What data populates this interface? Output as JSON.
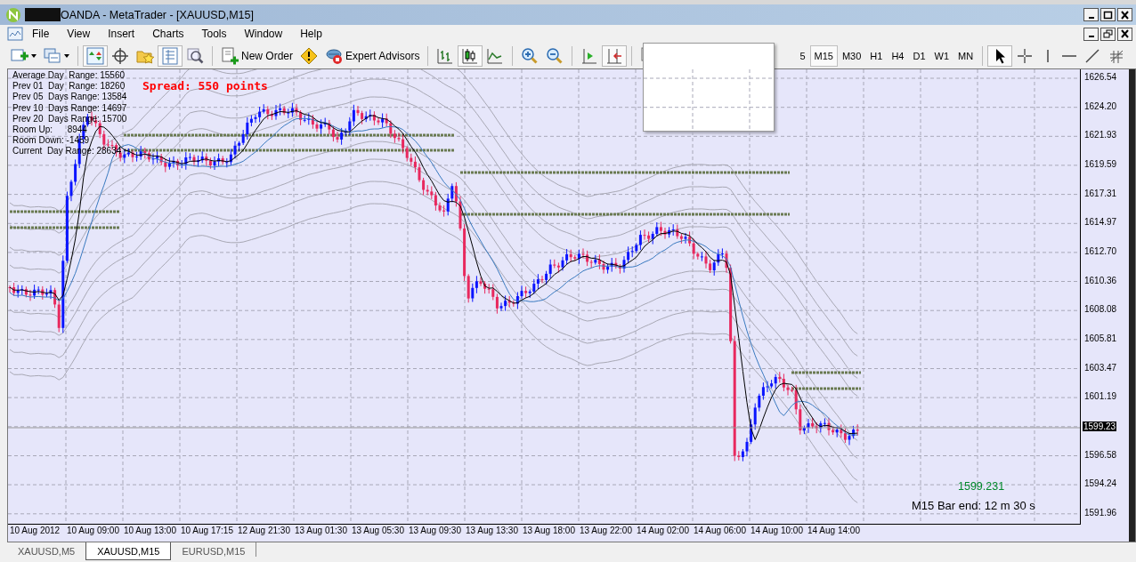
{
  "window": {
    "title": "OANDA - MetaTrader - [XAUUSD,M15]"
  },
  "menu": [
    "File",
    "View",
    "Insert",
    "Charts",
    "Tools",
    "Window",
    "Help"
  ],
  "toolbar": {
    "items": [
      {
        "kind": "icon",
        "pressed": false,
        "caret": true
      },
      {
        "kind": "icon",
        "pressed": false,
        "caret": true
      },
      {
        "kind": "sep"
      },
      {
        "kind": "icon",
        "pressed": true
      },
      {
        "kind": "icon",
        "pressed": false
      },
      {
        "kind": "icon",
        "pressed": false
      },
      {
        "kind": "icon",
        "pressed": true
      },
      {
        "kind": "icon",
        "pressed": false
      },
      {
        "kind": "sep"
      },
      {
        "kind": "text",
        "label": "New Order",
        "pressed": false
      },
      {
        "kind": "icon",
        "pressed": false
      },
      {
        "kind": "text",
        "label": "Expert Advisors",
        "pressed": false
      },
      {
        "kind": "sep"
      },
      {
        "kind": "icon",
        "pressed": false
      },
      {
        "kind": "icon",
        "pressed": true
      },
      {
        "kind": "icon",
        "pressed": false
      },
      {
        "kind": "sep"
      },
      {
        "kind": "icon",
        "pressed": false
      },
      {
        "kind": "icon",
        "pressed": false
      },
      {
        "kind": "sep"
      },
      {
        "kind": "icon",
        "pressed": false
      },
      {
        "kind": "icon",
        "pressed": true
      },
      {
        "kind": "sep"
      },
      {
        "kind": "icon"
      }
    ]
  },
  "timeframes": [
    {
      "label": "5",
      "selected": false
    },
    {
      "label": "M15",
      "selected": true
    },
    {
      "label": "M30",
      "selected": false
    },
    {
      "label": "H1",
      "selected": false
    },
    {
      "label": "H4",
      "selected": false
    },
    {
      "label": "D1",
      "selected": false
    },
    {
      "label": "W1",
      "selected": false
    },
    {
      "label": "MN",
      "selected": false
    }
  ],
  "drawing_tools": [
    {
      "pressed": true
    },
    {
      "pressed": false
    },
    {
      "pressed": false
    },
    {
      "pressed": false
    },
    {
      "pressed": false
    },
    {
      "pressed": false
    }
  ],
  "chart": {
    "info_lines": [
      "Average Day  Range: 15560",
      "Prev 01  Day  Range: 18260",
      "Prev 05  Days Range: 13584",
      "Prev 10  Days Range: 14697",
      "Prev 20  Days Range: 15700",
      "Room Up:      8944",
      "Room Down: -1459",
      "Current  Day Range: 28634"
    ],
    "spread": "Spread: 550 points",
    "bid": "1599.231",
    "bar_end": "M15 Bar end: 12 m 30 s",
    "price_labels": [
      "1626.54",
      "1624.20",
      "1621.93",
      "1619.59",
      "1617.31",
      "1614.97",
      "1612.70",
      "1610.36",
      "1608.08",
      "1605.81",
      "1603.47",
      "1601.19",
      "1596.58",
      "1594.24",
      "1591.96"
    ],
    "current_price": "1599.23",
    "time_labels": [
      "10 Aug 2012",
      "10 Aug 09:00",
      "10 Aug 13:00",
      "10 Aug 17:15",
      "12 Aug 21:30",
      "13 Aug 01:30",
      "13 Aug 05:30",
      "13 Aug 09:30",
      "13 Aug 13:30",
      "13 Aug 18:00",
      "13 Aug 22:00",
      "14 Aug 02:00",
      "14 Aug 06:00",
      "14 Aug 10:00",
      "14 Aug 14:00"
    ]
  },
  "tabs": [
    {
      "label": "XAUUSD,M5",
      "selected": false
    },
    {
      "label": "XAUUSD,M15",
      "selected": true
    },
    {
      "label": "EURUSD,M15",
      "selected": false
    }
  ]
}
